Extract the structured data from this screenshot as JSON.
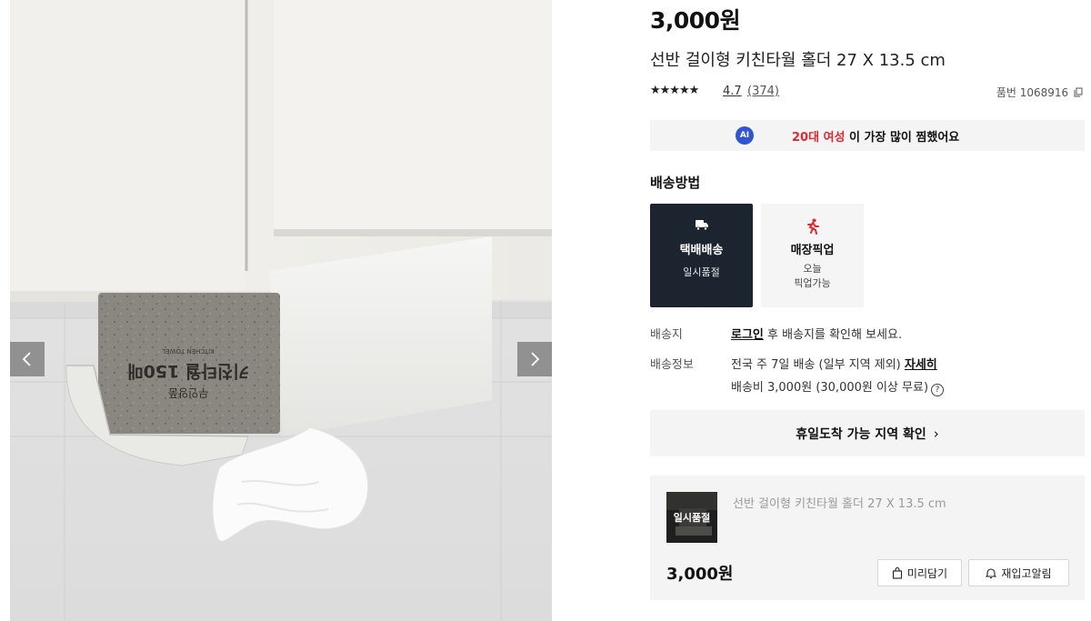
{
  "gallery": {
    "image_alt": "Kitchen towel holder hanging under a white shelf",
    "package_text_line1": "KITCHEN TOWEL",
    "package_text_line2": "키친타월 150매",
    "package_text_line3": "무인양품"
  },
  "product": {
    "price": "3,000원",
    "title": "선반 걸이형 키친타월 홀더 27 X 13.5 cm",
    "stars": "★★★★★",
    "rating": "4.7",
    "review_count": "(374)",
    "sku_label": "품번 1068916"
  },
  "ai_banner": {
    "badge": "AI",
    "highlight": "20대 여성",
    "text": " 이 가장 많이 찜했어요"
  },
  "shipping": {
    "heading": "배송방법",
    "options": [
      {
        "name": "택배배송",
        "status": "일시품절",
        "icon": "truck-icon",
        "selected": true
      },
      {
        "name": "매장픽업",
        "status_line1": "오늘",
        "status_line2": "픽업가능",
        "icon": "running-person-icon",
        "selected": false
      }
    ],
    "destination_label": "배송지",
    "destination_login": "로그인",
    "destination_text": " 후 배송지를 확인해 보세요.",
    "info_label": "배송정보",
    "info_text": "전국 주 7일 배송 (일부 지역 제외) ",
    "info_link": "자세히",
    "fee_text": "배송비 3,000원 (30,000원 이상 무료)",
    "fee_help": "?"
  },
  "holiday_check": {
    "label": "휴일도착 가능 지역 확인",
    "chevron": "›"
  },
  "summary": {
    "thumb_badge": "일시품절",
    "title": "선반 걸이형 키친타월 홀더 27 X 13.5 cm",
    "price": "3,000원",
    "wish_label": "미리담기",
    "restock_label": "재입고알림"
  },
  "colors": {
    "selected_option_bg": "#1c2430",
    "highlight_red": "#e0282e",
    "ai_blue": "#2f55d4",
    "panel_gray": "#f4f4f4"
  }
}
